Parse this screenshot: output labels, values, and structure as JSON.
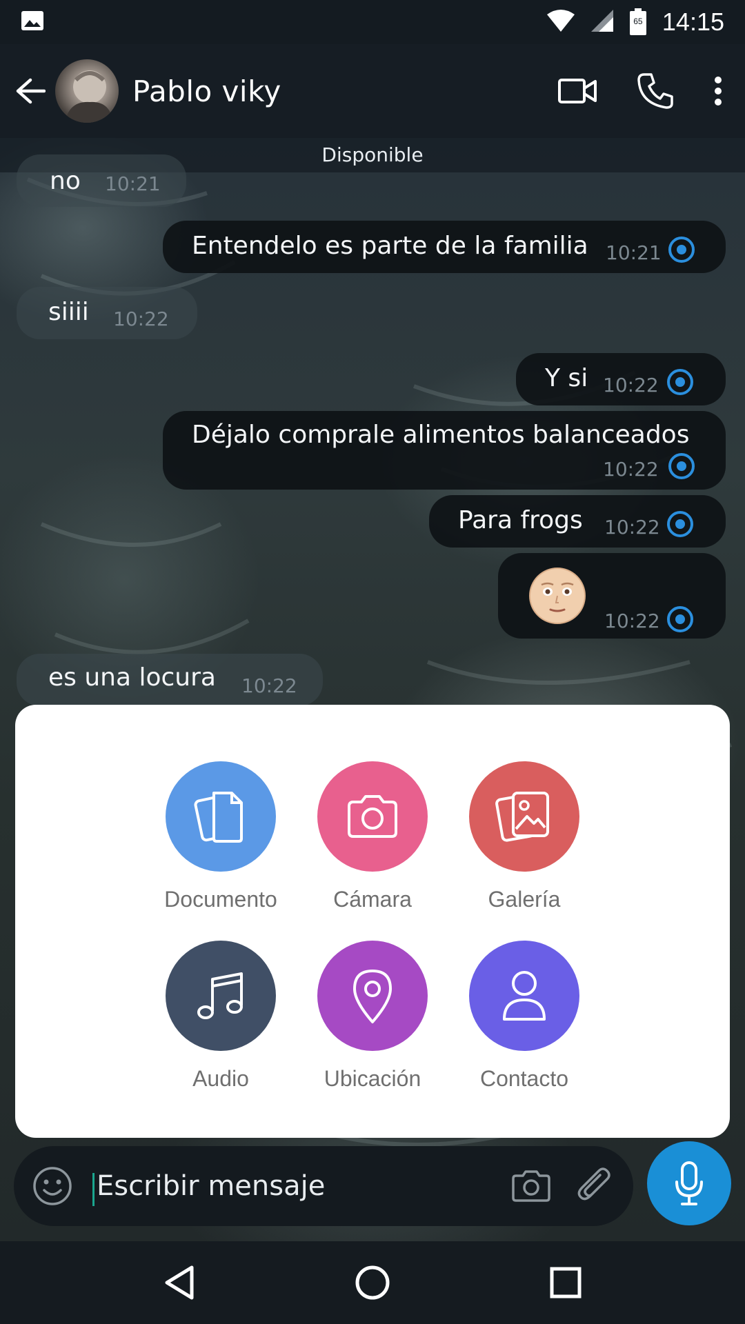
{
  "status_bar": {
    "time": "14:15",
    "battery": "65",
    "icons": [
      "image-icon",
      "wifi-icon",
      "signal-icon",
      "battery-icon"
    ]
  },
  "header": {
    "contact_name": "Pablo viky",
    "presence": "Disponible",
    "actions": [
      "video-call-icon",
      "phone-icon",
      "more-vert-icon"
    ]
  },
  "messages": [
    {
      "direction": "in",
      "text": "no",
      "time": "10:21"
    },
    {
      "direction": "out",
      "text": "Entendelo es parte de la familia",
      "time": "10:21"
    },
    {
      "direction": "in",
      "text": "siiii",
      "time": "10:22"
    },
    {
      "direction": "out",
      "text": "Y si",
      "time": "10:22"
    },
    {
      "direction": "out",
      "text": "Déjalo comprale alimentos balanceados",
      "time": "10:22"
    },
    {
      "direction": "out",
      "text": "Para frogs",
      "time": "10:22"
    },
    {
      "direction": "out",
      "text": "",
      "emoji": "face-emoji",
      "time": "10:22"
    },
    {
      "direction": "in",
      "text": "es una locura",
      "time": "10:22"
    }
  ],
  "attachments": [
    {
      "label": "Documento",
      "icon": "document-icon",
      "color": "#5b99e6"
    },
    {
      "label": "Cámara",
      "icon": "camera-icon",
      "color": "#e8608e"
    },
    {
      "label": "Galería",
      "icon": "gallery-icon",
      "color": "#d95e5e"
    },
    {
      "label": "Audio",
      "icon": "music-note-icon",
      "color": "#404f66"
    },
    {
      "label": "Ubicación",
      "icon": "location-pin-icon",
      "color": "#a64ac4"
    },
    {
      "label": "Contacto",
      "icon": "contact-icon",
      "color": "#6a5fe6"
    }
  ],
  "composer": {
    "placeholder": "Escribir mensaje",
    "mic_color": "#1a8fd6"
  },
  "colors": {
    "accent": "#1a8fd6",
    "tick": "#2b8fde"
  }
}
